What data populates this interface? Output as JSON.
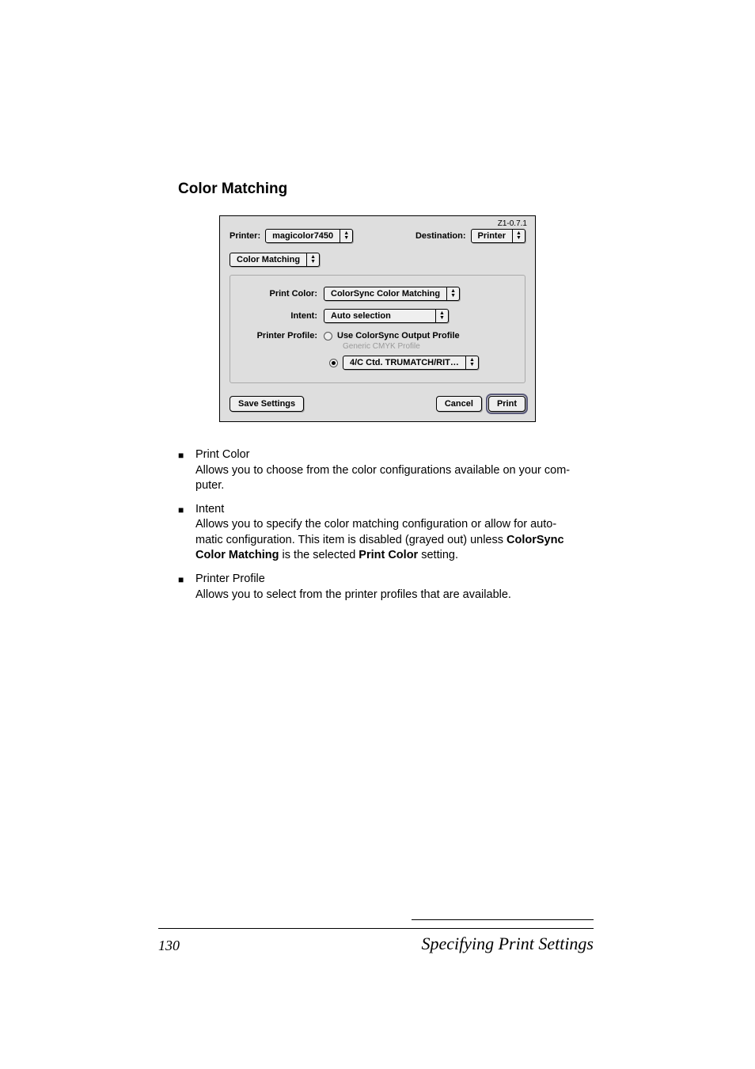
{
  "section": {
    "title": "Color Matching"
  },
  "dialog": {
    "version": "Z1-0.7.1",
    "printer_label": "Printer:",
    "printer_value": "magicolor7450",
    "destination_label": "Destination:",
    "destination_value": "Printer",
    "pane_value": "Color Matching",
    "print_color": {
      "label": "Print Color:",
      "value": "ColorSync Color Matching"
    },
    "intent": {
      "label": "Intent:",
      "value": "Auto selection"
    },
    "printer_profile": {
      "label": "Printer Profile:",
      "opt1": "Use ColorSync Output Profile",
      "opt1_caption": "Generic CMYK Profile",
      "opt2_value": "4/C Ctd. TRUMATCH/RIT…"
    },
    "buttons": {
      "save": "Save Settings",
      "cancel": "Cancel",
      "print": "Print"
    }
  },
  "bullets": {
    "b1": {
      "title": "Print Color",
      "desc_a": "Allows you to choose from the color configurations available on your com-",
      "desc_b": "puter."
    },
    "b2": {
      "title": "Intent",
      "line1": "Allows you to specify the color matching configuration or allow for auto-",
      "line2a": "matic configuration. This item is disabled (grayed out) unless ",
      "line2b": "ColorSync",
      "line3a": "Color Matching",
      "line3b": " is the selected ",
      "line3c": "Print Color",
      "line3d": " setting."
    },
    "b3": {
      "title": "Printer Profile",
      "desc": "Allows you to select from the printer profiles that are available."
    }
  },
  "footer": {
    "page": "130",
    "title": "Specifying Print Settings"
  }
}
